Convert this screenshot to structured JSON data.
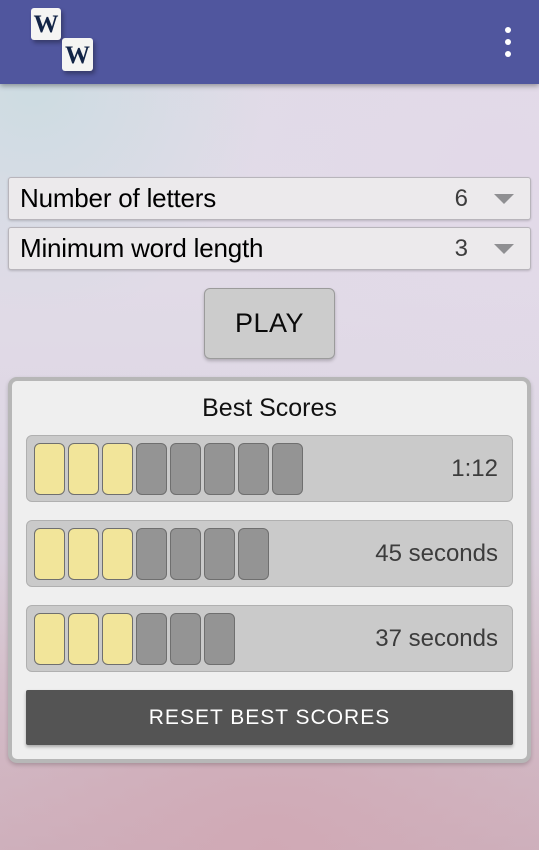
{
  "appbar": {
    "logo": {
      "tile_one": "W",
      "tile_two": "W",
      "icon": "word-tiles-logo"
    },
    "overflow_icon": "more-vert-icon",
    "background_color": "#50569e"
  },
  "settings": {
    "spinners": [
      {
        "label": "Number of letters",
        "value": "6",
        "caret_icon": "chevron-down-icon"
      },
      {
        "label": "Minimum word length",
        "value": "3",
        "caret_icon": "chevron-down-icon"
      }
    ]
  },
  "play": {
    "label": "PLAY"
  },
  "scores": {
    "title": "Best Scores",
    "rows": [
      {
        "filled": 3,
        "empty": 5,
        "time": "1:12"
      },
      {
        "filled": 3,
        "empty": 4,
        "time": "45 seconds"
      },
      {
        "filled": 3,
        "empty": 3,
        "time": "37 seconds"
      }
    ],
    "reset_label": "RESET BEST SCORES",
    "tile_filled_color": "#f2e59a",
    "tile_empty_color": "#949494"
  }
}
